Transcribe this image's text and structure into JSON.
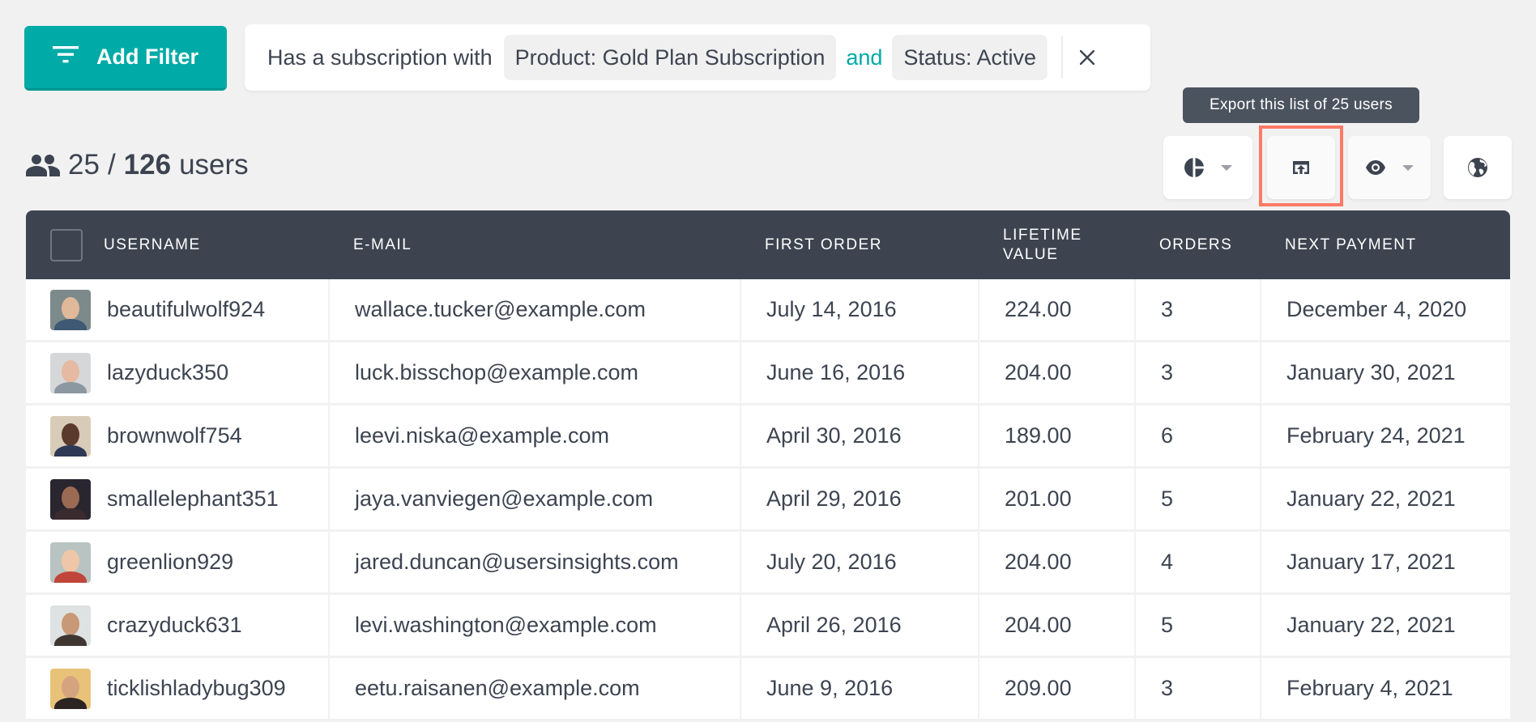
{
  "toolbar": {
    "add_filter_label": "Add Filter",
    "add_filter_icon": "filter-list-icon"
  },
  "filter": {
    "lead": "Has a subscription with",
    "conditions": [
      {
        "label": "Product: Gold Plan Subscription"
      },
      {
        "label": "Status: Active"
      }
    ],
    "joiner": "and",
    "clear_icon": "close-icon"
  },
  "count": {
    "icon": "people-icon",
    "filtered": "25",
    "separator": "/",
    "total": "126",
    "unit": "users"
  },
  "tooltip": {
    "text": "Export this list of 25 users"
  },
  "tools": [
    {
      "name": "segments",
      "icon": "pie-chart-icon",
      "has_dropdown": true
    },
    {
      "name": "export",
      "icon": "export-icon",
      "has_dropdown": false,
      "highlighted": true
    },
    {
      "name": "columns",
      "icon": "eye-icon",
      "has_dropdown": true
    },
    {
      "name": "map",
      "icon": "globe-icon",
      "has_dropdown": false
    }
  ],
  "colors": {
    "accent": "#00aaa6",
    "header_bg": "#3d4450",
    "highlight": "#fd7a67",
    "tooltip_bg": "#4b535f",
    "text": "#3d4451"
  },
  "table": {
    "columns": [
      "Username",
      "E-mail",
      "First Order",
      "Lifetime Value",
      "Orders",
      "Next Payment"
    ],
    "rows": [
      {
        "username": "beautifulwolf924",
        "email": "wallace.tucker@example.com",
        "first_order": "July 14, 2016",
        "lifetime_value": "224.00",
        "orders": "3",
        "next_payment": "December 4, 2020"
      },
      {
        "username": "lazyduck350",
        "email": "luck.bisschop@example.com",
        "first_order": "June 16, 2016",
        "lifetime_value": "204.00",
        "orders": "3",
        "next_payment": "January 30, 2021"
      },
      {
        "username": "brownwolf754",
        "email": "leevi.niska@example.com",
        "first_order": "April 30, 2016",
        "lifetime_value": "189.00",
        "orders": "6",
        "next_payment": "February 24, 2021"
      },
      {
        "username": "smallelephant351",
        "email": "jaya.vanviegen@example.com",
        "first_order": "April 29, 2016",
        "lifetime_value": "201.00",
        "orders": "5",
        "next_payment": "January 22, 2021"
      },
      {
        "username": "greenlion929",
        "email": "jared.duncan@usersinsights.com",
        "first_order": "July 20, 2016",
        "lifetime_value": "204.00",
        "orders": "4",
        "next_payment": "January 17, 2021"
      },
      {
        "username": "crazyduck631",
        "email": "levi.washington@example.com",
        "first_order": "April 26, 2016",
        "lifetime_value": "204.00",
        "orders": "5",
        "next_payment": "January 22, 2021"
      },
      {
        "username": "ticklishladybug309",
        "email": "eetu.raisanen@example.com",
        "first_order": "June 9, 2016",
        "lifetime_value": "209.00",
        "orders": "3",
        "next_payment": "February 4, 2021"
      }
    ]
  }
}
